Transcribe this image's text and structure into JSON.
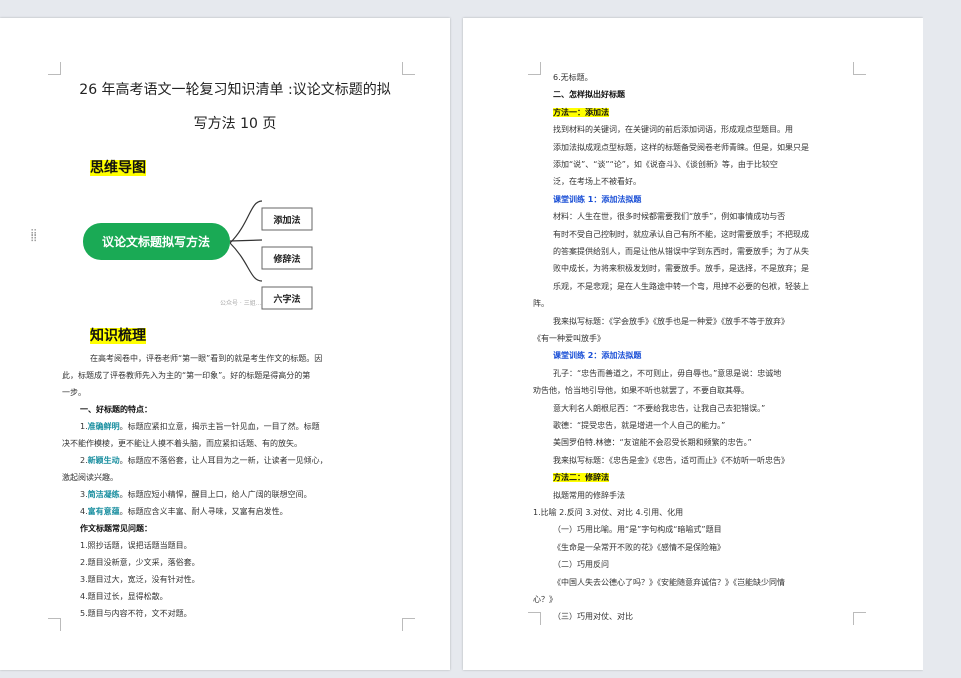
{
  "page1": {
    "title_line1": "26 年高考语文一轮复习知识清单 :议论文标题的拟",
    "title_line2": "写方法 10 页",
    "mindmap_heading": "思维导图",
    "mindmap": {
      "center": "议论文标题拟写方法",
      "branches": [
        "添加法",
        "修辞法",
        "六字法"
      ],
      "watermark": "公众号 · 三姐…"
    },
    "knowledge_heading": "知识梳理",
    "intro": [
      "在高考阅卷中，评卷老师“第一眼”看到的就是考生作文的标题。因",
      "此，标题成了评卷教师先入为主的“第一印象”。好的标题是得高分的第",
      "一步。"
    ],
    "features_heading": "一、好标题的特点：",
    "features": [
      {
        "num": "1.",
        "key": "准确鲜明",
        "rest": "。标题应紧扣立意，揭示主旨一针见血，一目了然。标题",
        "cont": "决不能作模棱，更不能让人摸不着头脑，而应紧扣话题、有的放矢。"
      },
      {
        "num": "2.",
        "key": "新颖生动",
        "rest": "。标题应不落俗套，让人耳目为之一新，让读者一见倾心，",
        "cont": "激起阅读兴趣。"
      },
      {
        "num": "3.",
        "key": "简洁凝练",
        "rest": "。标题应短小精悍，醒目上口，给人广阔的联想空间。",
        "cont": ""
      },
      {
        "num": "4.",
        "key": "富有意蕴",
        "rest": "。标题应含义丰富、耐人寻味，又富有启发性。",
        "cont": ""
      }
    ],
    "problems_heading": "作文标题常见问题：",
    "problems": [
      "1.照抄话题，误把话题当题目。",
      "2.题目没新意，少文采，落俗套。",
      "3.题目过大，宽泛，没有针对性。",
      "4.题目过长，显得松散。",
      "5.题目与内容不符，文不对题。"
    ]
  },
  "page2": {
    "lines": [
      {
        "text": "6.无标题。",
        "style": "normal"
      },
      {
        "text": "二、怎样拟出好标题",
        "style": "bold"
      },
      {
        "text": "方法一：添加法",
        "style": "hl"
      },
      {
        "text": "找到材料的关键词，在关键词的前后添加词语，形成观点型题目。用",
        "style": "normal"
      },
      {
        "text": "添加法拟成观点型标题，这样的标题备受阅卷老师青睐。但是，如果只是",
        "style": "normal"
      },
      {
        "text": "添加“说”、“谈”“论”，如《说奋斗》、《谈创新》等，由于比较空",
        "style": "normal"
      },
      {
        "text": "泛，在考场上不被看好。",
        "style": "normal"
      },
      {
        "text": "课堂训练 1：添加法拟题",
        "style": "blue"
      },
      {
        "text": "材料：人生在世，很多时候都需要我们“放手”，例如事情成功与否",
        "style": "normal"
      },
      {
        "text": "有时不受自己控制时，就应承认自己有所不能，这时需要放手；不把现成",
        "style": "normal"
      },
      {
        "text": "的答案提供给别人，而是让他从错误中学到东西时，需要放手；为了从失",
        "style": "normal"
      },
      {
        "text": "败中成长，为将来积极发划时，需要放手。放手，是选择，不是放弃；是",
        "style": "normal"
      },
      {
        "text": "乐观，不是悲观；是在人生路途中转一个弯，甩掉不必要的包袱，轻装上",
        "style": "normal"
      },
      {
        "text": "阵。",
        "style": "flush"
      },
      {
        "text": "我来拟写标题：《学会放手》《放手也是一种爱》《放手不等于放弃》",
        "style": "normal"
      },
      {
        "text": "《有一种爱叫放手》",
        "style": "flush"
      },
      {
        "text": "课堂训练 2：添加法拟题",
        "style": "blue"
      },
      {
        "text": "孔子：“忠告而善道之，不可则止，毋自辱也。”意思是说：忠诚地",
        "style": "normal"
      },
      {
        "text": "劝告他，恰当地引导他，如果不听也就罢了，不要自取其辱。",
        "style": "flush"
      },
      {
        "text": "意大利名人朗根尼西：“不要给我忠告，让我自己去犯错误。”",
        "style": "normal"
      },
      {
        "text": "歌德：“提受忠告，就是增进一个人自己的能力。”",
        "style": "normal"
      },
      {
        "text": "美国罗伯特.林德：“友谊能不会忍受长期和频繁的忠告。”",
        "style": "normal"
      },
      {
        "text": "我来拟写标题：《忠告是金》《忠告，适可而止》《不妨听一听忠告》",
        "style": "normal"
      },
      {
        "text": "方法二：修辞法",
        "style": "hl"
      },
      {
        "text": "拟题常用的修辞手法",
        "style": "normal"
      },
      {
        "text": "1.比喻 2.反问          3.对仗、对比          4.引用、化用",
        "style": "flush"
      },
      {
        "text": "（一）巧用比喻。用“是”字句构成“暗喻式”题目",
        "style": "normal"
      },
      {
        "text": "《生命是一朵常开不败的花》《感情不是保险箱》",
        "style": "normal"
      },
      {
        "text": "（二）巧用反问",
        "style": "normal"
      },
      {
        "text": "《中国人失去公德心了吗？》《安能随意弃诚信？》《岂能缺少同情",
        "style": "normal"
      },
      {
        "text": "心？》",
        "style": "flush"
      },
      {
        "text": "（三）巧用对仗、对比",
        "style": "normal"
      }
    ]
  }
}
